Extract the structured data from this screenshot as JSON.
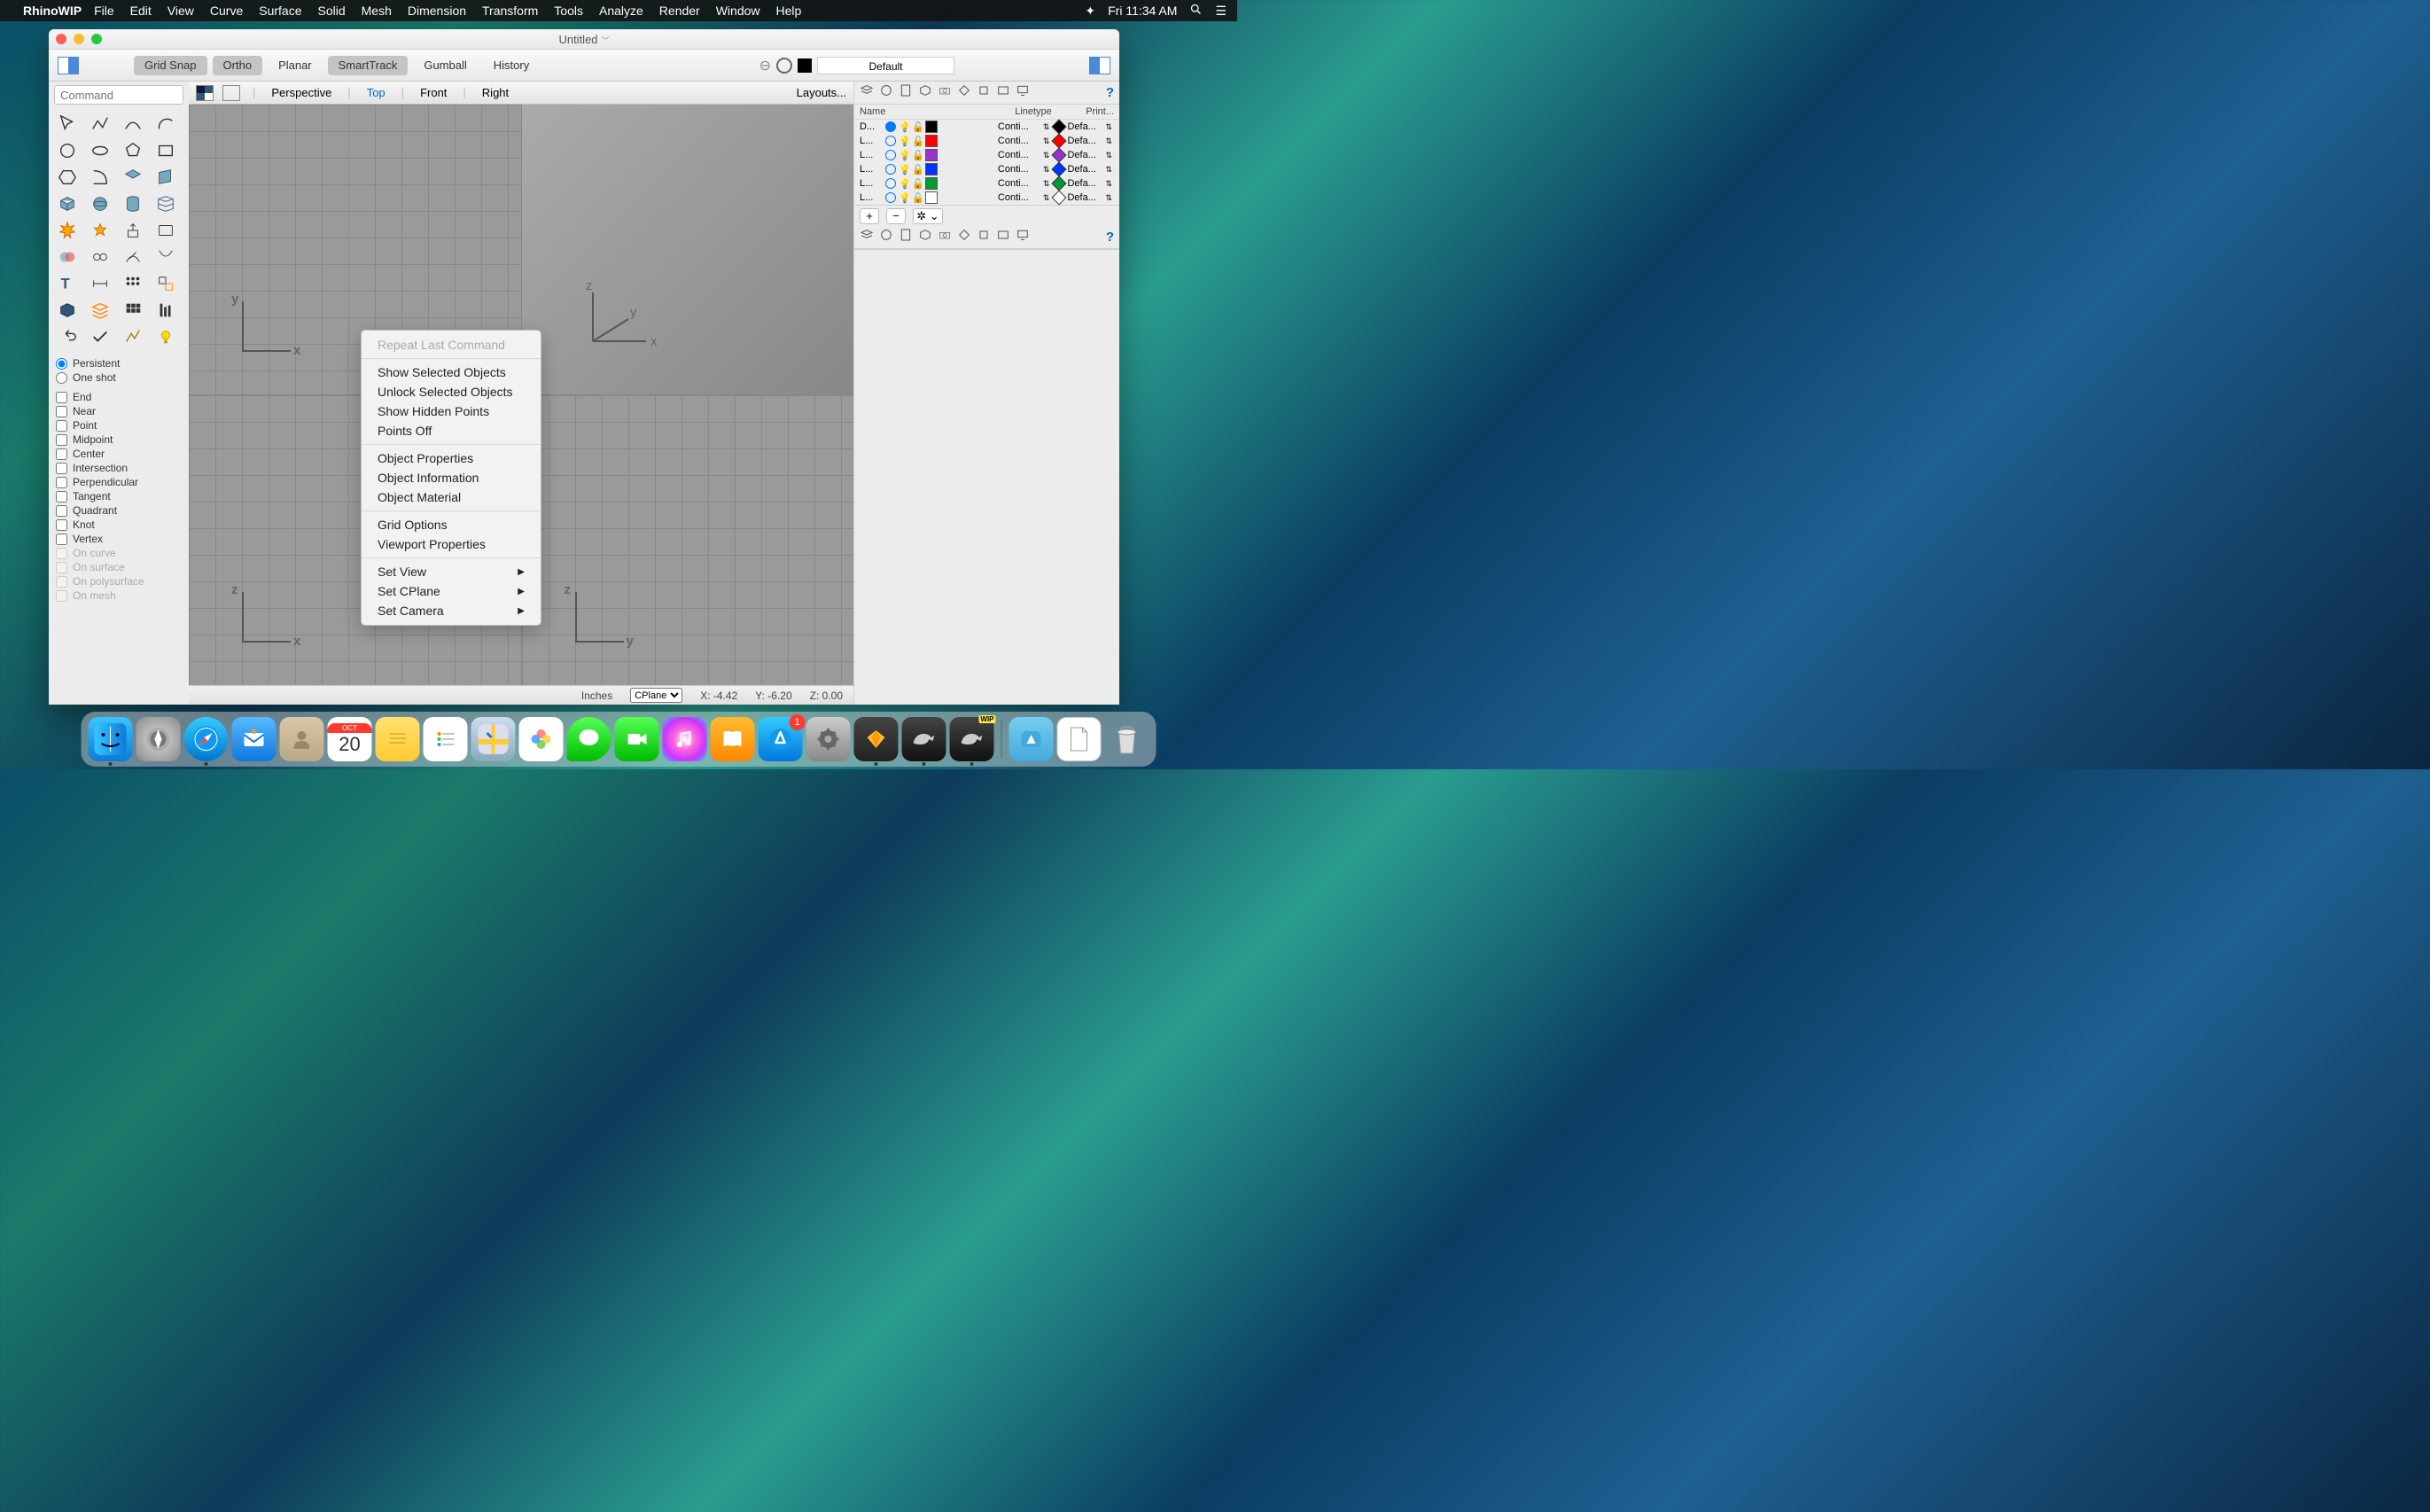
{
  "menubar": {
    "app": "RhinoWIP",
    "menus": [
      "File",
      "Edit",
      "View",
      "Curve",
      "Surface",
      "Solid",
      "Mesh",
      "Dimension",
      "Transform",
      "Tools",
      "Analyze",
      "Render",
      "Window",
      "Help"
    ],
    "clock": "Fri 11:34 AM"
  },
  "window": {
    "title": "Untitled",
    "toolbar": {
      "gridsnap": "Grid Snap",
      "ortho": "Ortho",
      "planar": "Planar",
      "smarttrack": "SmartTrack",
      "gumball": "Gumball",
      "history": "History",
      "layersel": "Default"
    },
    "command_placeholder": "Command"
  },
  "viewtabs": {
    "tabs": [
      "Perspective",
      "Top",
      "Front",
      "Right"
    ],
    "active": "Top",
    "layouts": "Layouts..."
  },
  "osnap": {
    "persistent": "Persistent",
    "oneshot": "One shot",
    "opts": [
      "End",
      "Near",
      "Point",
      "Midpoint",
      "Center",
      "Intersection",
      "Perpendicular",
      "Tangent",
      "Quadrant",
      "Knot",
      "Vertex"
    ],
    "dim_opts": [
      "On curve",
      "On surface",
      "On polysurface",
      "On mesh"
    ]
  },
  "layers": {
    "hdr_name": "Name",
    "hdr_lt": "Linetype",
    "hdr_print": "Print...",
    "rows": [
      {
        "name": "D...",
        "current": true,
        "color": "#000000",
        "diam": "#000000",
        "lt": "Conti...",
        "print": "Defa..."
      },
      {
        "name": "L...",
        "current": false,
        "color": "#ff0000",
        "diam": "#ff0000",
        "lt": "Conti...",
        "print": "Defa..."
      },
      {
        "name": "L...",
        "current": false,
        "color": "#9933cc",
        "diam": "#9933cc",
        "lt": "Conti...",
        "print": "Defa..."
      },
      {
        "name": "L...",
        "current": false,
        "color": "#0033ff",
        "diam": "#0033ff",
        "lt": "Conti...",
        "print": "Defa..."
      },
      {
        "name": "L...",
        "current": false,
        "color": "#009933",
        "diam": "#009933",
        "lt": "Conti...",
        "print": "Defa..."
      },
      {
        "name": "L...",
        "current": false,
        "color": "#ffffff",
        "diam": "#ffffff",
        "lt": "Conti...",
        "print": "Defa..."
      }
    ]
  },
  "context_menu": {
    "items": [
      {
        "label": "Repeat Last Command",
        "disabled": true
      },
      {
        "sep": true
      },
      {
        "label": "Show Selected Objects"
      },
      {
        "label": "Unlock Selected Objects"
      },
      {
        "label": "Show Hidden Points"
      },
      {
        "label": "Points Off"
      },
      {
        "sep": true
      },
      {
        "label": "Object Properties"
      },
      {
        "label": "Object Information"
      },
      {
        "label": "Object Material"
      },
      {
        "sep": true
      },
      {
        "label": "Grid Options"
      },
      {
        "label": "Viewport Properties"
      },
      {
        "sep": true
      },
      {
        "label": "Set View",
        "submenu": true
      },
      {
        "label": "Set CPlane",
        "submenu": true
      },
      {
        "label": "Set Camera",
        "submenu": true
      }
    ]
  },
  "status": {
    "units": "Inches",
    "cplane": "CPlane",
    "x": "X: -4.42",
    "y": "Y: -6.20",
    "z": "Z: 0.00"
  },
  "dock": {
    "appstore_badge": "1",
    "calendar_day": "20",
    "calendar_month": "OCT"
  }
}
